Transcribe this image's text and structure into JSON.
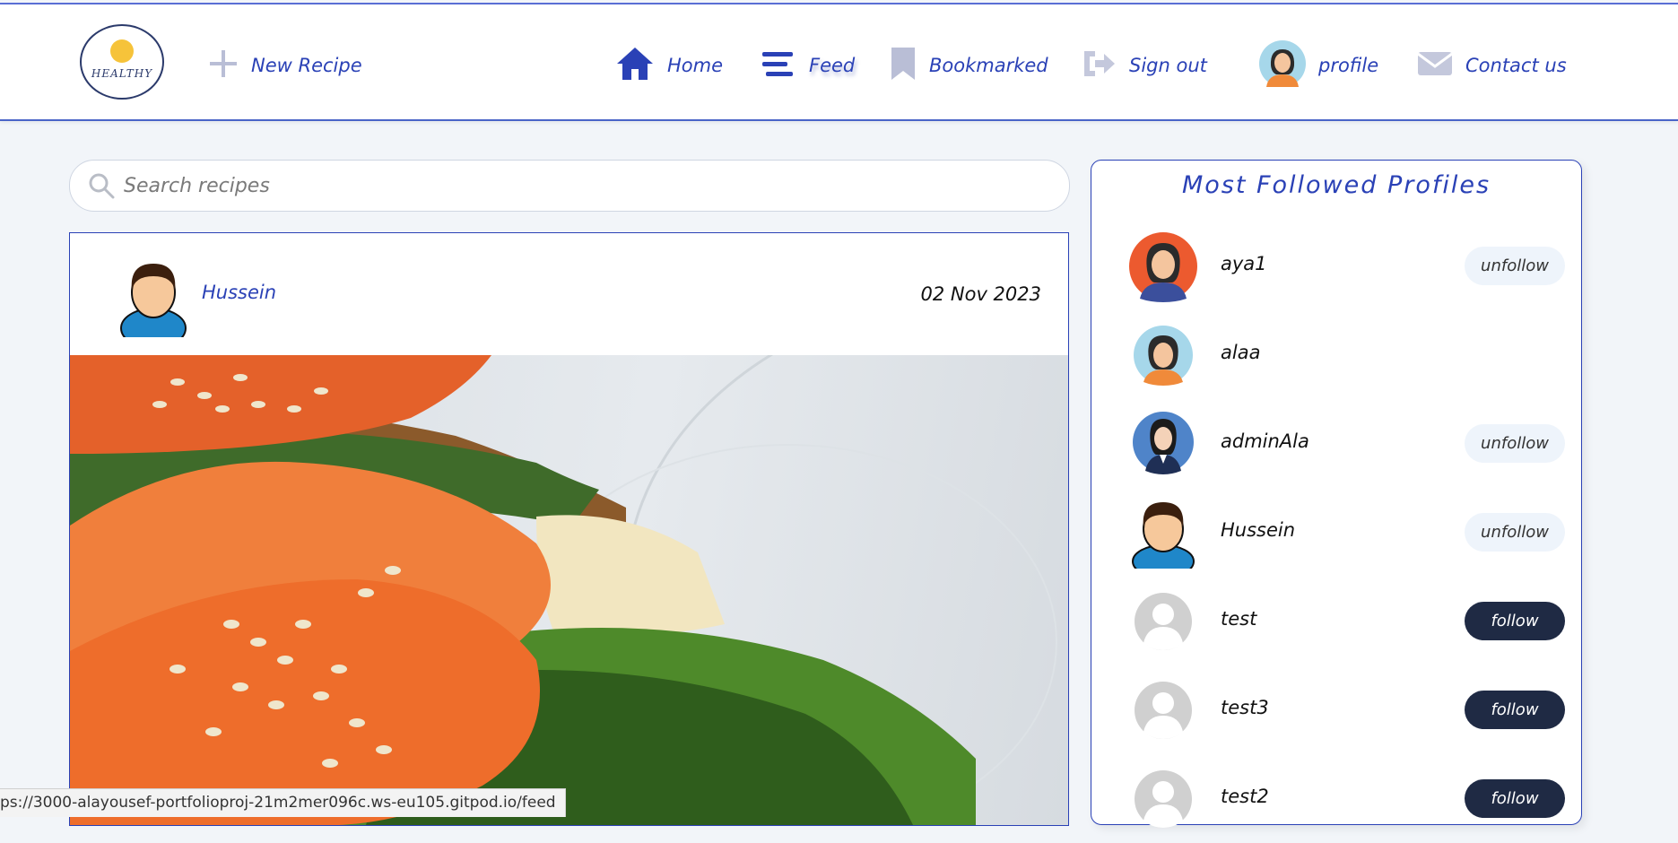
{
  "brand": {
    "logo_text": "HEALTHY"
  },
  "nav": {
    "new_recipe": "New Recipe",
    "home": "Home",
    "feed": "Feed",
    "bookmarked": "Bookmarked",
    "sign_out": "Sign out",
    "profile": "profile",
    "contact": "Contact us"
  },
  "search": {
    "placeholder": "Search recipes",
    "value": ""
  },
  "post": {
    "author": "Hussein",
    "date": "02 Nov 2023"
  },
  "sidebar": {
    "title": "Most Followed Profiles",
    "profiles": [
      {
        "name": "aya1",
        "button": "unfollow"
      },
      {
        "name": "alaa",
        "button": ""
      },
      {
        "name": "adminAla",
        "button": "unfollow"
      },
      {
        "name": "Hussein",
        "button": "unfollow"
      },
      {
        "name": "test",
        "button": "follow"
      },
      {
        "name": "test3",
        "button": "follow"
      },
      {
        "name": "test2",
        "button": "follow"
      }
    ]
  },
  "status_url": "ps://3000-alayousef-portfolioproj-21m2mer096c.ws-eu105.gitpod.io/feed",
  "colors": {
    "accent": "#2a41b6",
    "follow_bg": "#1f2a44",
    "unfollow_bg": "#eef4fb",
    "page_bg": "#f2f5f9"
  }
}
